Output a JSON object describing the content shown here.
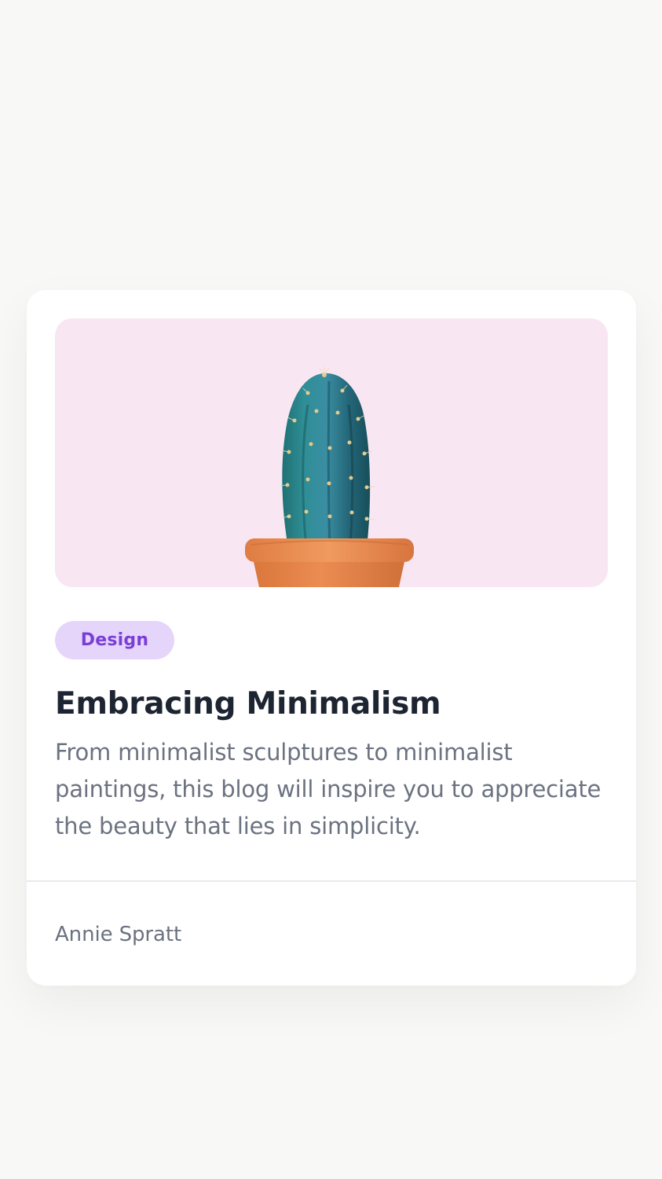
{
  "card": {
    "image_alt": "Cactus in a terracotta pot",
    "tag": "Design",
    "title": "Embracing Minimalism",
    "description": "From minimalist sculptures to minimalist paintings, this blog will inspire you to appreciate the beauty that lies in simplicity.",
    "author": "Annie Spratt"
  },
  "colors": {
    "page_background": "#f8f8f7",
    "card_background": "#ffffff",
    "image_background": "#f8e7f2",
    "tag_background": "#e6d5fb",
    "tag_text": "#7a3fd6",
    "title_text": "#1e2532",
    "description_text": "#6b7280",
    "author_text": "#6b7280",
    "divider": "#e8e9ef"
  }
}
